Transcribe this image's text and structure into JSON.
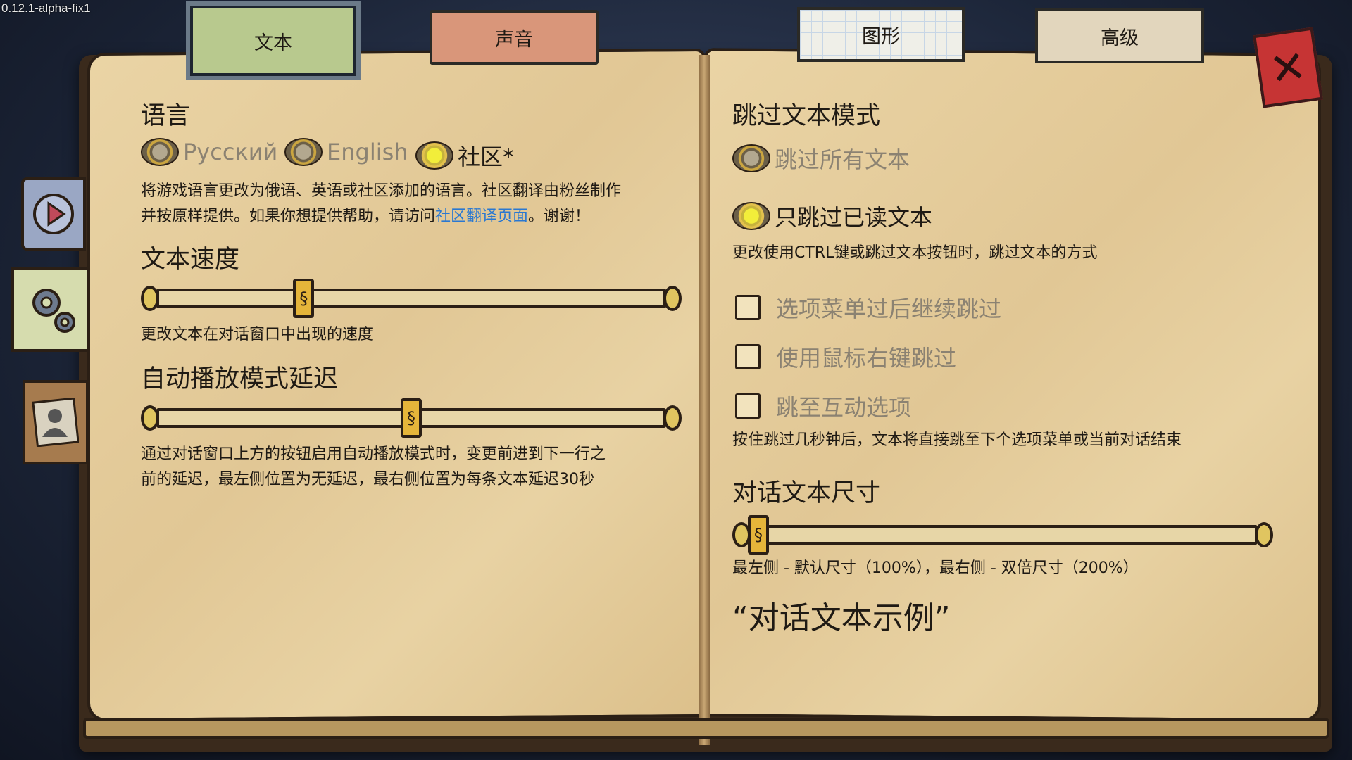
{
  "version": "0.12.1-alpha-fix1",
  "tabs": {
    "text": "文本",
    "sound": "声音",
    "graphics": "图形",
    "advanced": "高级"
  },
  "close_icon": "close-icon",
  "left": {
    "language": {
      "heading": "语言",
      "options": [
        {
          "label": "Русский",
          "selected": false
        },
        {
          "label": "English",
          "selected": false
        },
        {
          "label": "社区*",
          "selected": true
        }
      ],
      "desc_line1": "将游戏语言更改为俄语、英语或社区添加的语言。社区翻译由粉丝制作",
      "desc_line2_pre": "并按原样提供。如果你想提供帮助，请访问",
      "desc_link": "社区翻译页面",
      "desc_line2_post": "。谢谢！"
    },
    "text_speed": {
      "heading": "文本速度",
      "value": 0.28,
      "desc": "更改文本在对话窗口中出现的速度"
    },
    "autoplay": {
      "heading": "自动播放模式延迟",
      "value": 0.5,
      "desc_line1": "通过对话窗口上方的按钮启用自动播放模式时，变更前进到下一行之",
      "desc_line2": "前的延迟，最左侧位置为无延迟，最右侧位置为每条文本延迟30秒"
    }
  },
  "right": {
    "skip_mode": {
      "heading": "跳过文本模式",
      "options": [
        {
          "label": "跳过所有文本",
          "selected": false
        },
        {
          "label": "只跳过已读文本",
          "selected": true
        }
      ],
      "desc": "更改使用CTRL键或跳过文本按钮时，跳过文本的方式"
    },
    "checkboxes": [
      {
        "label": "选项菜单过后继续跳过",
        "checked": false
      },
      {
        "label": "使用鼠标右键跳过",
        "checked": false
      },
      {
        "label": "跳至互动选项",
        "checked": false
      }
    ],
    "checkbox_desc": "按住跳过几秒钟后，文本将直接跳至下个选项菜单或当前对话结束",
    "text_size": {
      "heading": "对话文本尺寸",
      "value": 0.0,
      "desc": "最左侧 - 默认尺寸（100%），最右侧 - 双倍尺寸（200%）",
      "sample": "“对话文本示例”"
    }
  }
}
